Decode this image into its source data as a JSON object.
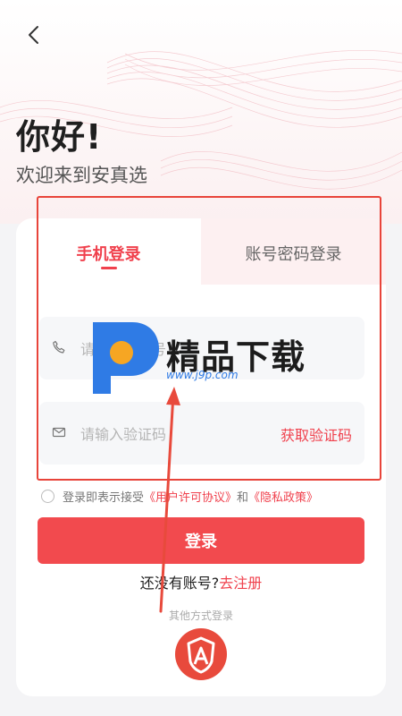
{
  "greeting": "你好!",
  "welcome": "欢迎来到安真选",
  "tabs": {
    "phone_login": "手机登录",
    "account_login": "账号密码登录"
  },
  "phone_field": {
    "placeholder": "请输入手机号",
    "icon": "phone-icon"
  },
  "code_field": {
    "placeholder": "请输入验证码",
    "icon": "mail-icon",
    "get_code": "获取验证码"
  },
  "agreement": {
    "prefix": "登录即表示接受",
    "terms": "《用户许可协议》",
    "and": "和",
    "privacy": "《隐私政策》"
  },
  "login_button": "登录",
  "signup": {
    "prompt": "还没有账号?",
    "link": "去注册"
  },
  "other_login": "其他方式登录",
  "watermark": {
    "title": "精品下载",
    "url": "www.j9p.com"
  },
  "colors": {
    "accent": "#f0414d",
    "button": "#f24a4e",
    "annotation": "#e8443a"
  }
}
